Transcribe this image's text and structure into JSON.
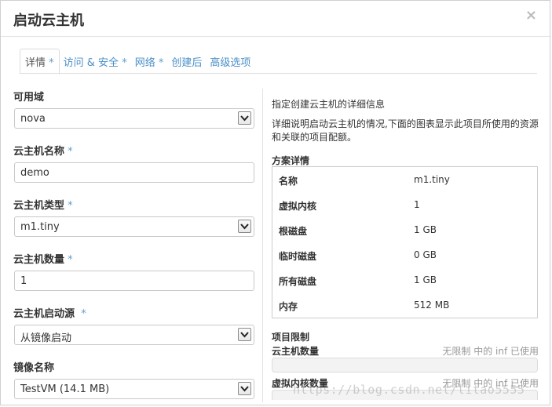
{
  "modal": {
    "title": "启动云主机",
    "close_glyph": "×"
  },
  "tabs": [
    {
      "label": "详情",
      "star": " *"
    },
    {
      "label": "访问 & 安全",
      "star": " *"
    },
    {
      "label": "网络",
      "star": " *"
    },
    {
      "label": "创建后",
      "star": ""
    },
    {
      "label": "高级选项",
      "star": ""
    }
  ],
  "form": {
    "availability_zone": {
      "label": "可用域",
      "required": "",
      "value": "nova"
    },
    "instance_name": {
      "label": "云主机名称",
      "required": " *",
      "value": "demo"
    },
    "flavor": {
      "label": "云主机类型",
      "required": " *",
      "value": "m1.tiny"
    },
    "instance_count": {
      "label": "云主机数量",
      "required": " *",
      "value": "1"
    },
    "boot_source": {
      "label": "云主机启动源",
      "required": "  *",
      "value": "从镜像启动"
    },
    "image_name": {
      "label": "镜像名称",
      "required": "",
      "value": "TestVM (14.1 MB)"
    }
  },
  "info": {
    "intro": "指定创建云主机的详细信息",
    "description": "详细说明启动云主机的情况,下面的图表显示此项目所使用的资源和关联的项目配额。"
  },
  "flavor_details": {
    "title": "方案详情",
    "rows": [
      {
        "name": "名称",
        "value": "m1.tiny"
      },
      {
        "name": "虚拟内核",
        "value": "1"
      },
      {
        "name": "根磁盘",
        "value": "1 GB"
      },
      {
        "name": "临时磁盘",
        "value": "0 GB"
      },
      {
        "name": "所有磁盘",
        "value": "1 GB"
      },
      {
        "name": "内存",
        "value": "512 MB"
      }
    ]
  },
  "project_limits": {
    "title": "项目限制",
    "items": [
      {
        "label": "云主机数量",
        "status": "无限制 中的 inf 已使用",
        "used_fraction": 0
      },
      {
        "label": "虚拟内核数量",
        "status": "无限制 中的 inf 已使用",
        "used_fraction": 0
      }
    ]
  },
  "watermark": "https://blog.csdn.net/litao5555"
}
